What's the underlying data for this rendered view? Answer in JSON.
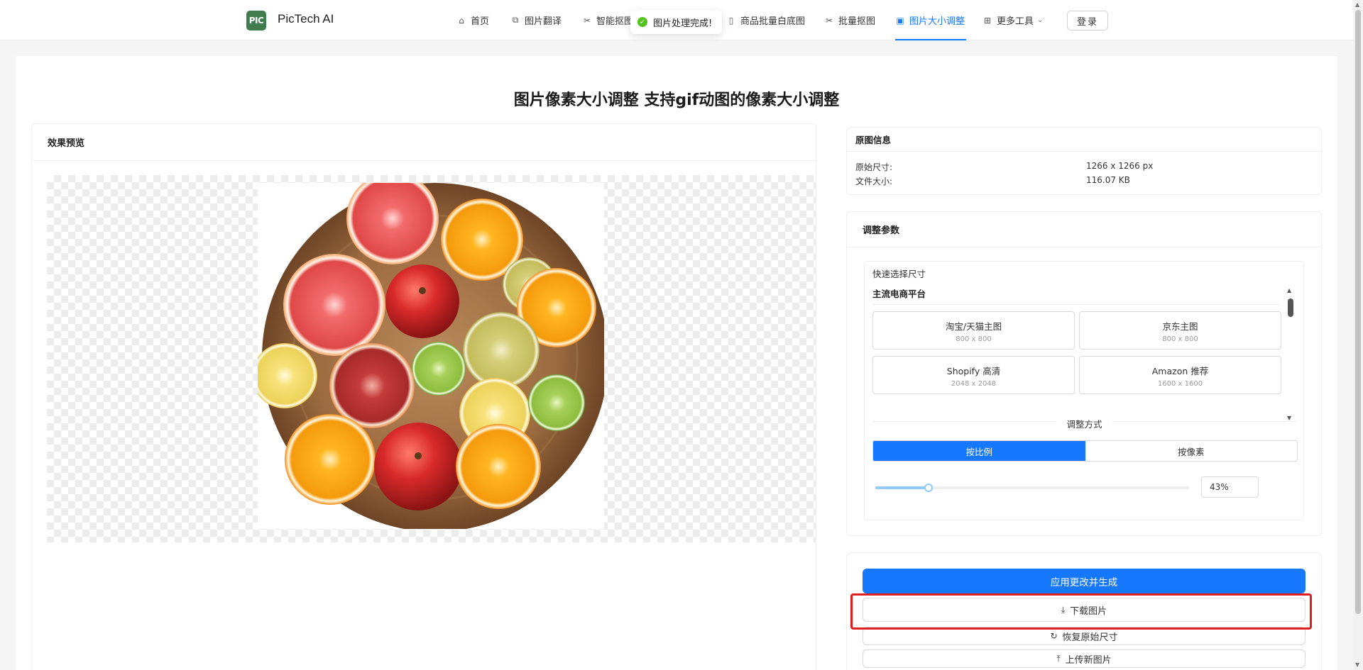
{
  "brand": {
    "logo_text": "PIC",
    "name": "PicTech AI"
  },
  "nav": {
    "items": [
      {
        "label": "首页",
        "icon": "home-icon"
      },
      {
        "label": "图片翻译",
        "icon": "translate-icon"
      },
      {
        "label": "智能抠图",
        "icon": "scissors-icon"
      },
      {
        "label": "商品批量白底图",
        "icon": "file-icon"
      },
      {
        "label": "批量抠图",
        "icon": "scissors-icon"
      },
      {
        "label": "图片大小调整",
        "icon": "image-icon",
        "active": true
      },
      {
        "label": "更多工具",
        "icon": "grid-icon"
      }
    ],
    "login_label": "登录"
  },
  "toast": {
    "text": "图片处理完成!",
    "icon": "check-circle-icon"
  },
  "page": {
    "title": "图片像素大小调整 支持gif动图的像素大小调整"
  },
  "preview": {
    "title": "效果预览"
  },
  "info": {
    "title": "原图信息",
    "rows": [
      {
        "label": "原始尺寸:",
        "value": "1266 x 1266 px"
      },
      {
        "label": "文件大小:",
        "value": "116.07 KB"
      }
    ]
  },
  "params": {
    "title": "调整参数",
    "quick_label": "快速选择尺寸",
    "platform_group": "主流电商平台",
    "sizes": [
      {
        "name": "淘宝/天猫主图",
        "dims": "800 x 800"
      },
      {
        "name": "京东主图",
        "dims": "800 x 800"
      },
      {
        "name": "Shopify 高清",
        "dims": "2048 x 2048"
      },
      {
        "name": "Amazon 推荐",
        "dims": "1600 x 1600"
      }
    ],
    "method_label": "调整方式",
    "method_options": [
      "按比例",
      "按像素"
    ],
    "method_selected": "按比例",
    "percent_value": "43%",
    "slider_fraction": 0.17
  },
  "actions": {
    "apply": "应用更改并生成",
    "download": "下载图片",
    "reset": "恢复原始尺寸",
    "upload": "上传新图片"
  },
  "colors": {
    "primary": "#1677ff",
    "highlight": "#e01e1e",
    "logo": "#3f7d4f",
    "success": "#52c41a"
  }
}
